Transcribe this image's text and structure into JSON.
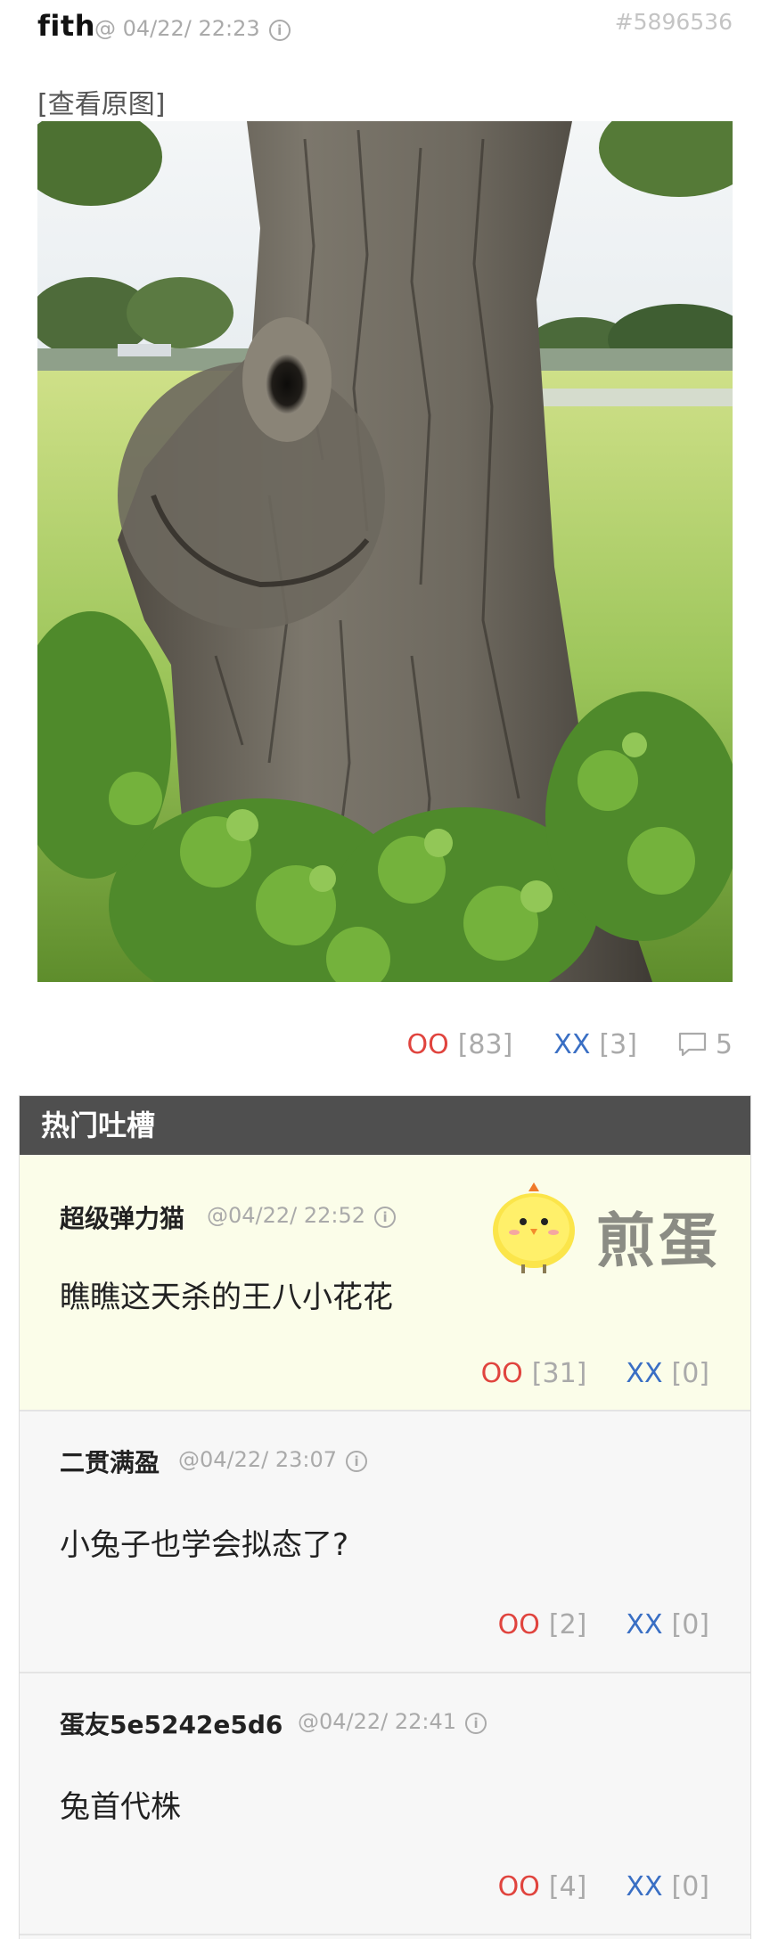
{
  "post": {
    "author": "fith",
    "time": "@ 04/22/ 22:23",
    "id": "#5896536",
    "view_original": "[查看原图]",
    "votes": {
      "oo_label": "OO",
      "oo_count": "[83]",
      "xx_label": "XX",
      "xx_count": "[3]"
    },
    "comments_count": "5"
  },
  "hot_section": {
    "title": "热门吐槽",
    "brand": "煎蛋",
    "comments": [
      {
        "author": "超级弹力猫",
        "time": "@04/22/ 22:52",
        "text": "瞧瞧这天杀的王八小花花",
        "oo_label": "OO",
        "oo_count": "[31]",
        "xx_label": "XX",
        "xx_count": "[0]"
      },
      {
        "author": "二贯满盈",
        "time": "@04/22/ 23:07",
        "text": "小兔子也学会拟态了?",
        "oo_label": "OO",
        "oo_count": "[2]",
        "xx_label": "XX",
        "xx_count": "[0]"
      },
      {
        "author": "蛋友5e5242e5d6",
        "time": "@04/22/ 22:41",
        "text": "兔首代株",
        "oo_label": "OO",
        "oo_count": "[4]",
        "xx_label": "XX",
        "xx_count": "[0]"
      }
    ]
  },
  "icons": {
    "info": "info-circle-icon",
    "comment": "speech-bubble-icon",
    "mascot": "chick-mascot-icon"
  },
  "colors": {
    "oo": "#e0443e",
    "xx": "#3a6fc4",
    "hot_header": "#4f4f4f",
    "hot_bg": "#fbfde9",
    "muted": "#aaaaaa"
  }
}
